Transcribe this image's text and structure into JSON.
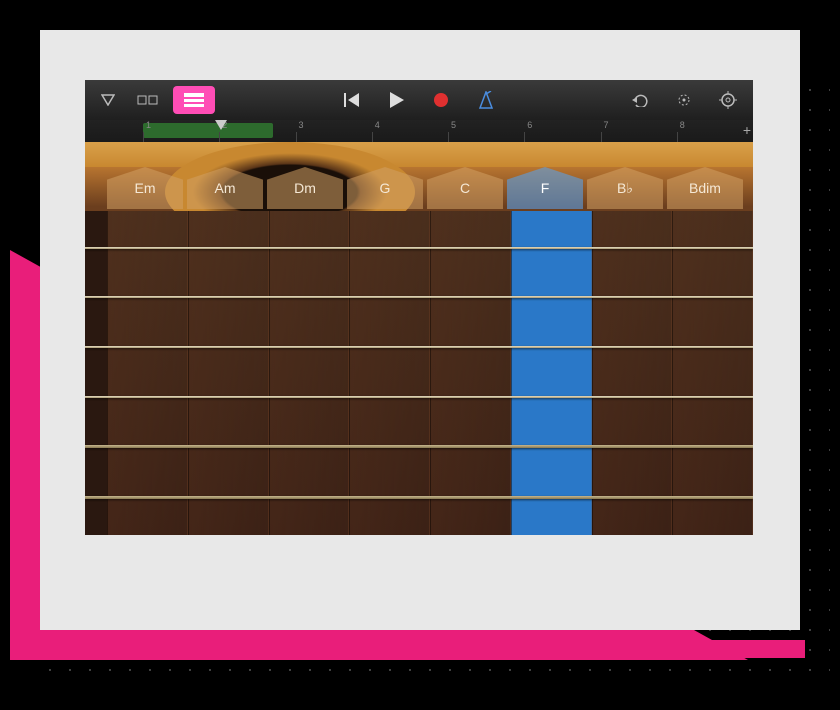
{
  "toolbar": {
    "browser_icon": "browser",
    "view_toggle_1": "notes-view",
    "view_toggle_2": "chord-strips-view",
    "rewind": "rewind",
    "play": "play",
    "record": "record",
    "metronome": "metronome",
    "undo": "undo",
    "master": "master-fx",
    "settings": "settings"
  },
  "ruler": {
    "bars": [
      "1",
      "2",
      "3",
      "4",
      "5",
      "6",
      "7",
      "8"
    ],
    "add": "+"
  },
  "chords": [
    {
      "label": "Em",
      "active": false
    },
    {
      "label": "Am",
      "active": false
    },
    {
      "label": "Dm",
      "active": false
    },
    {
      "label": "G",
      "active": false
    },
    {
      "label": "C",
      "active": false
    },
    {
      "label": "F",
      "active": true
    },
    {
      "label": "B♭",
      "active": false
    },
    {
      "label": "Bdim",
      "active": false
    }
  ],
  "strings_count": 6,
  "colors": {
    "accent_pink": "#ff4db5",
    "record_red": "#e03030",
    "metronome_blue": "#4a8de0",
    "active_chord_blue": "#2a78c8"
  }
}
